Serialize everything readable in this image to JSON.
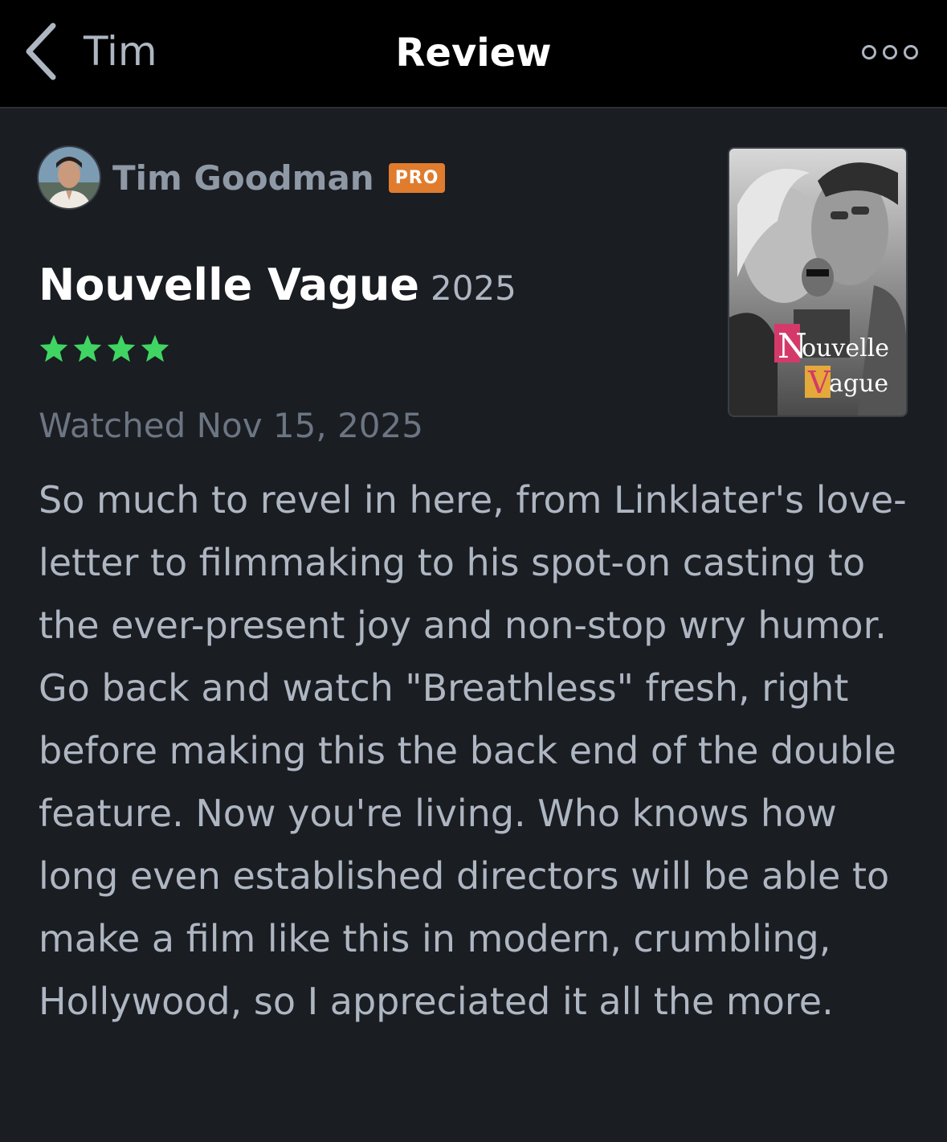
{
  "navbar": {
    "back_label": "Tim",
    "title": "Review",
    "back_icon": "chevron-left-icon",
    "more_icon": "more-horizontal-icon"
  },
  "author": {
    "name": "Tim Goodman",
    "badge": "PRO"
  },
  "film": {
    "title": "Nouvelle Vague",
    "year": "2025",
    "poster_text": {
      "line1_initial": "N",
      "line1_rest": "ouvelle",
      "line2_initial": "V",
      "line2_rest": "ague"
    }
  },
  "rating": {
    "stars": 4,
    "max": 5,
    "color": "#40d463"
  },
  "watched": "Watched Nov 15, 2025",
  "review_text": "So much to revel in here, from Linklater's love-letter to filmmaking to his spot-on casting to the ever-present joy and non-stop wry humor. Go back and watch \"Breathless\" fresh, right before making this the back end of the double feature. Now you're living. Who knows how long even established directors will be able to make a film like this in modern, crumbling, Hollywood, so I appreciated it all the more.",
  "colors": {
    "background": "#1a1d22",
    "navbar": "#000000",
    "pro_badge": "#e07c2e",
    "body_text": "#aeb6c2",
    "muted_text": "#6c7582"
  }
}
